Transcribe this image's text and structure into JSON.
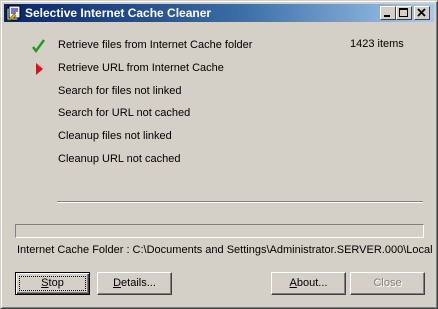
{
  "window": {
    "title": "Selective Internet Cache Cleaner",
    "icon": "app-cache-icon",
    "controls": [
      "minimize-icon",
      "maximize-icon",
      "close-icon"
    ]
  },
  "tasks": [
    {
      "label": "Retrieve files from Internet Cache folder",
      "status": "done",
      "status_icon": "check-icon",
      "count": "1423 items"
    },
    {
      "label": "Retrieve URL from Internet Cache",
      "status": "current",
      "status_icon": "arrow-right-icon",
      "count": ""
    },
    {
      "label": "Search for files not linked",
      "status": "pending",
      "count": ""
    },
    {
      "label": "Search for URL not cached",
      "status": "pending",
      "count": ""
    },
    {
      "label": "Cleanup files not linked",
      "status": "pending",
      "count": ""
    },
    {
      "label": "Cleanup URL not cached",
      "status": "pending",
      "count": ""
    }
  ],
  "progress": {
    "value": 0
  },
  "folder_line": "Internet Cache Folder : C:\\Documents and Settings\\Administrator.SERVER.000\\Local",
  "buttons": {
    "stop": {
      "prefix": "",
      "accel": "S",
      "rest": "top"
    },
    "details": {
      "prefix": "",
      "accel": "D",
      "rest": "etails..."
    },
    "about": {
      "prefix": "",
      "accel": "A",
      "rest": "bout..."
    },
    "close": {
      "label": "Close"
    }
  },
  "colors": {
    "title_start": "#0a246a",
    "title_end": "#a6caf0",
    "check": "#1f9a1f",
    "arrow": "#e01010",
    "face": "#d4d0c8"
  }
}
